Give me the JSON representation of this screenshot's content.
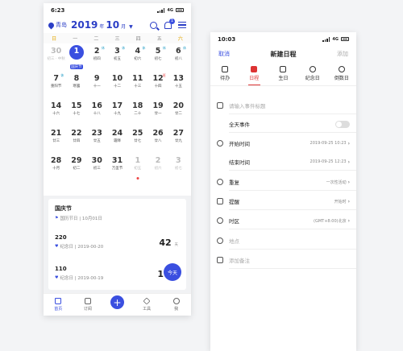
{
  "left": {
    "status_time": "6:23",
    "network": "4G",
    "city": "青岛",
    "year": "2019",
    "year_unit": "年",
    "month": "10",
    "month_unit": "月",
    "badge": "1",
    "weekdays": [
      "日",
      "一",
      "二",
      "三",
      "四",
      "五",
      "六"
    ],
    "days": [
      {
        "d": "30",
        "l": "初三 · 中秋",
        "dim": true
      },
      {
        "d": "1",
        "l": "国庆节",
        "today": true
      },
      {
        "d": "2",
        "l": "初四",
        "mark": "休"
      },
      {
        "d": "3",
        "l": "初五",
        "mark": "休"
      },
      {
        "d": "4",
        "l": "初六",
        "mark": "休"
      },
      {
        "d": "5",
        "l": "初七",
        "mark": "休"
      },
      {
        "d": "6",
        "l": "初八",
        "mark": "休"
      },
      {
        "d": "7",
        "l": "重阳节",
        "mark": "休"
      },
      {
        "d": "8",
        "l": "寒露"
      },
      {
        "d": "9",
        "l": "十一"
      },
      {
        "d": "10",
        "l": "十二"
      },
      {
        "d": "11",
        "l": "十三"
      },
      {
        "d": "12",
        "l": "十四",
        "mark": "班",
        "red": true
      },
      {
        "d": "13",
        "l": "十五"
      },
      {
        "d": "14",
        "l": "十六"
      },
      {
        "d": "15",
        "l": "十七"
      },
      {
        "d": "16",
        "l": "十八"
      },
      {
        "d": "17",
        "l": "十九"
      },
      {
        "d": "18",
        "l": "二十"
      },
      {
        "d": "19",
        "l": "廿一"
      },
      {
        "d": "20",
        "l": "廿二"
      },
      {
        "d": "21",
        "l": "廿三"
      },
      {
        "d": "22",
        "l": "廿四"
      },
      {
        "d": "23",
        "l": "廿五"
      },
      {
        "d": "24",
        "l": "霜降"
      },
      {
        "d": "25",
        "l": "廿七"
      },
      {
        "d": "26",
        "l": "廿八"
      },
      {
        "d": "27",
        "l": "廿九"
      },
      {
        "d": "28",
        "l": "十月"
      },
      {
        "d": "29",
        "l": "初二"
      },
      {
        "d": "30",
        "l": "初三"
      },
      {
        "d": "31",
        "l": "万圣节"
      },
      {
        "d": "1",
        "l": "初五",
        "dim": true,
        "dot": "#e44"
      },
      {
        "d": "2",
        "l": "初六",
        "dim": true
      },
      {
        "d": "3",
        "l": "初七",
        "dim": true
      }
    ],
    "events": [
      {
        "title": "国庆节",
        "sub": "国历节日 | 10月01日"
      },
      {
        "title": "220",
        "sub": "纪念日 | 2019-00-20",
        "days": "42",
        "unit": "天"
      },
      {
        "title": "110",
        "sub": "纪念日 | 2019-00-19",
        "days": "1"
      }
    ],
    "today_label": "今天",
    "tabs": [
      "首页",
      "订阅",
      "",
      "工具",
      "我"
    ]
  },
  "right": {
    "status_time": "10:03",
    "network": "4G",
    "cancel": "取消",
    "title": "新建日程",
    "add": "添加",
    "types": [
      "待办",
      "日程",
      "生日",
      "纪念日",
      "倒数日"
    ],
    "title_placeholder": "请输入事件标题",
    "all_day": "全天事件",
    "start_label": "开始时间",
    "start_value": "2019-09-25 10:23",
    "end_label": "结束时间",
    "end_value": "2019-09-25 12:23",
    "repeat_label": "重复",
    "repeat_value": "一次性活动",
    "remind_label": "提醒",
    "remind_value": "开始时",
    "tz_label": "时区",
    "tz_value": "(GMT+8:00)北京",
    "location_placeholder": "地点",
    "note_placeholder": "添加备注"
  }
}
